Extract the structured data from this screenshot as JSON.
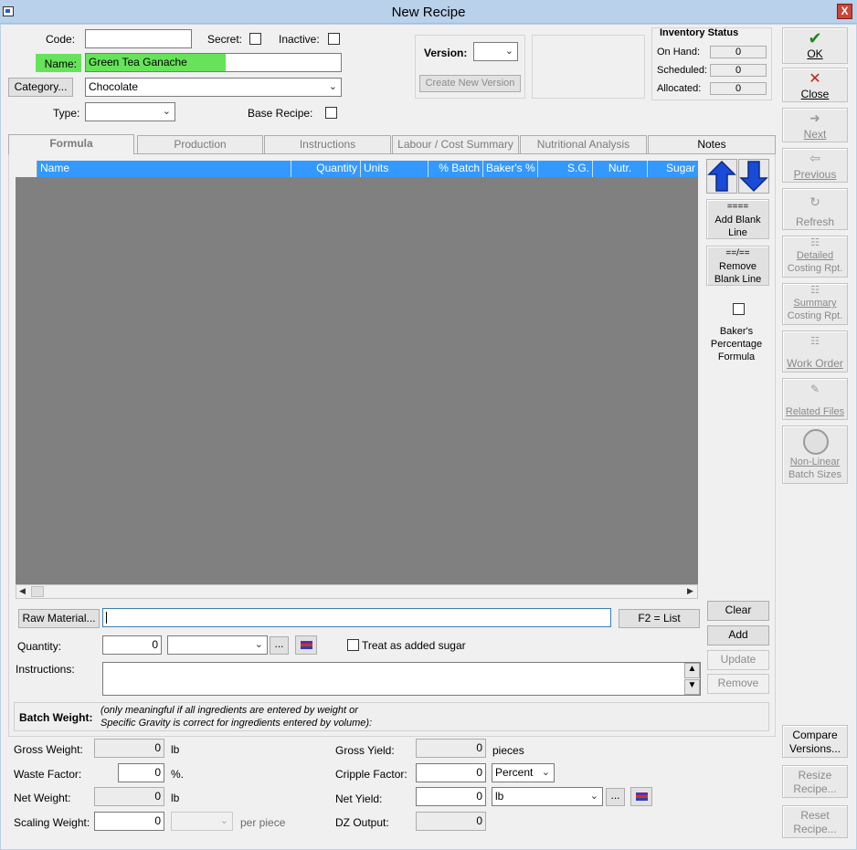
{
  "window": {
    "title": "New Recipe",
    "close_glyph": "X"
  },
  "header": {
    "code_label": "Code:",
    "code_value": "",
    "secret_label": "Secret:",
    "inactive_label": "Inactive:",
    "name_label": "Name:",
    "name_value": "Green Tea Ganache",
    "category_button": "Category...",
    "category_value": "Chocolate",
    "type_label": "Type:",
    "type_value": "",
    "base_recipe_label": "Base Recipe:",
    "version_label": "Version:",
    "version_value": "",
    "create_version_button": "Create New Version"
  },
  "inventory": {
    "title": "Inventory Status",
    "rows": [
      {
        "label": "On Hand:",
        "value": "0"
      },
      {
        "label": "Scheduled:",
        "value": "0"
      },
      {
        "label": "Allocated:",
        "value": "0"
      }
    ]
  },
  "sidebar": {
    "ok": "OK",
    "close": "Close",
    "next": "Next",
    "previous": "Previous",
    "refresh": "Refresh",
    "detailed_l1": "Detailed",
    "detailed_l2": "Costing Rpt.",
    "summary_l1": "Summary",
    "summary_l2": "Costing Rpt.",
    "work_order": "Work Order",
    "related_files": "Related Files",
    "nonlinear_l1": "Non-Linear",
    "nonlinear_l2": "Batch Sizes",
    "compare_l1": "Compare",
    "compare_l2": "Versions...",
    "resize_l1": "Resize",
    "resize_l2": "Recipe...",
    "reset_l1": "Reset",
    "reset_l2": "Recipe..."
  },
  "tabs": [
    "Formula",
    "Production",
    "Instructions",
    "Labour / Cost Summary",
    "Nutritional Analysis",
    "Notes"
  ],
  "grid": {
    "columns": [
      "Name",
      "Quantity",
      "Units",
      "% Batch",
      "Baker's %",
      "S.G.",
      "Nutr.",
      "Sugar"
    ]
  },
  "formula_tools": {
    "add_blank_icon": "====",
    "add_blank_l1": "Add Blank",
    "add_blank_l2": "Line",
    "remove_blank_icon": "==/==",
    "remove_blank_l1": "Remove",
    "remove_blank_l2": "Blank Line",
    "bakers_l1": "Baker's",
    "bakers_l2": "Percentage",
    "bakers_l3": "Formula"
  },
  "entry": {
    "raw_material_button": "Raw Material...",
    "raw_material_value": "",
    "f2_button": "F2 = List",
    "clear_button": "Clear",
    "add_button": "Add",
    "update_button": "Update",
    "remove_button": "Remove",
    "quantity_label": "Quantity:",
    "quantity_value": "0",
    "unit_value": "",
    "ellipsis": "...",
    "treat_sugar_label": "Treat as added sugar",
    "instructions_label": "Instructions:",
    "instructions_value": ""
  },
  "batch": {
    "title": "Batch Weight:",
    "note_l1": "(only meaningful if all ingredients are entered by weight or",
    "note_l2": "Specific Gravity is correct for ingredients entered by volume):",
    "gross_weight_label": "Gross Weight:",
    "gross_weight_value": "0",
    "gross_weight_unit": "lb",
    "waste_factor_label": "Waste Factor:",
    "waste_factor_value": "0",
    "waste_factor_unit": "%.",
    "net_weight_label": "Net Weight:",
    "net_weight_value": "0",
    "net_weight_unit": "lb",
    "scaling_weight_label": "Scaling Weight:",
    "scaling_weight_value": "0",
    "scaling_unit_value": "",
    "per_piece": "per piece",
    "gross_yield_label": "Gross Yield:",
    "gross_yield_value": "0",
    "gross_yield_unit": "pieces",
    "cripple_factor_label": "Cripple Factor:",
    "cripple_factor_value": "0",
    "cripple_mode": "Percent",
    "net_yield_label": "Net Yield:",
    "net_yield_value": "0",
    "net_yield_unit": "lb",
    "dz_output_label": "DZ Output:",
    "dz_output_value": "0"
  },
  "colors": {
    "titlebar": "#b9d1ea",
    "name_highlight": "#66e35a",
    "grid_header": "#3399ff",
    "grid_body": "#808080",
    "ok_check": "#1c8a1c",
    "close_x": "#c0231a",
    "arrow_blue": "#1a4bd6"
  }
}
